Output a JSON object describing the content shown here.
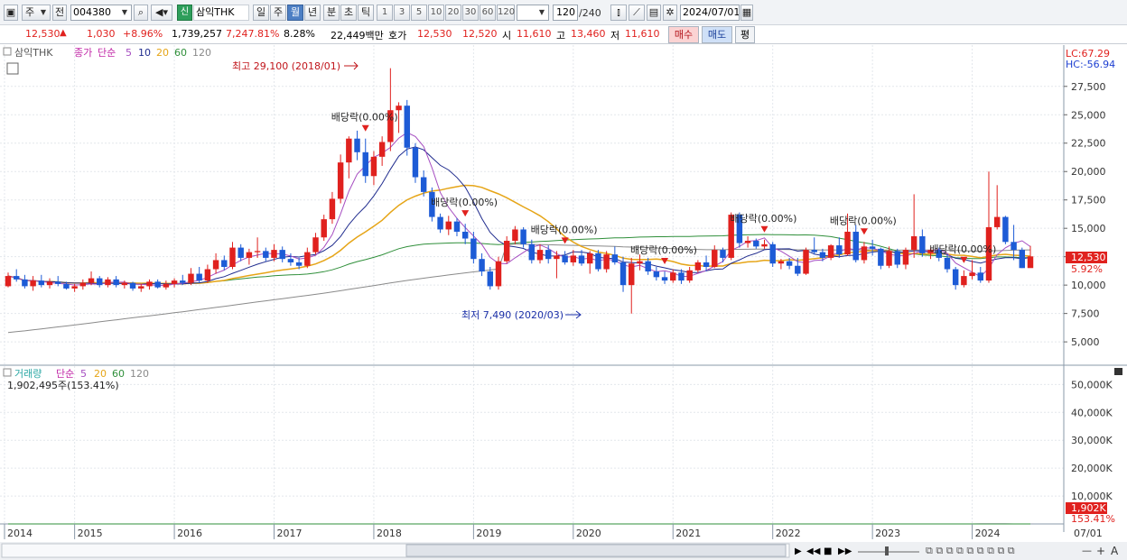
{
  "toolbar": {
    "mode": "주",
    "prev": "전",
    "code": "004380",
    "badge": "신",
    "name": "삼익THK",
    "periods": [
      "일",
      "주",
      "월",
      "년",
      "분",
      "초",
      "틱"
    ],
    "active_period": "월",
    "nums": [
      "1",
      "3",
      "5",
      "10",
      "20",
      "30",
      "60",
      "120"
    ],
    "count": "120",
    "total": "/240",
    "date": "2024/07/01"
  },
  "quote": {
    "price": "12,530",
    "arrow": "▲",
    "change": "1,030",
    "pct": "+8.96%",
    "volume": "1,739,257",
    "vol_ratio": "7,247.81%",
    "turnover": "8.28%",
    "amount": "22,449백만",
    "hoga_label": "호가",
    "ask": "12,530",
    "bid": "12,520",
    "open_label": "시",
    "open": "11,610",
    "high_label": "고",
    "high": "13,460",
    "low_label": "저",
    "low": "11,610",
    "buy": "매수",
    "sell": "매도",
    "avg": "평"
  },
  "price_panel": {
    "name": "삼익THK",
    "legend": [
      "종가",
      "단순",
      "5",
      "10",
      "20",
      "60",
      "120"
    ],
    "lc": "LC:67.29",
    "hc": "HC:-56.94",
    "max_label": "최고 29,100 (2018/01)",
    "min_label": "최저 7,490 (2020/03)",
    "last_price": "12,530",
    "last_pct": "5.92%",
    "ticks": [
      "27,500",
      "25,000",
      "22,500",
      "20,000",
      "17,500",
      "15,000",
      "12,500",
      "10,000",
      "7,500",
      "5,000"
    ],
    "dividends": [
      {
        "label": "배당락(0.00%)",
        "date": "2017/12"
      },
      {
        "label": "배당락(0.00%)",
        "date": "2018/12"
      },
      {
        "label": "배당락(0.00%)",
        "date": "2019/12"
      },
      {
        "label": "배당락(0.00%)",
        "date": "2020/12"
      },
      {
        "label": "배당락(0.00%)",
        "date": "2021/12"
      },
      {
        "label": "배당락(0.00%)",
        "date": "2022/12"
      },
      {
        "label": "배당락(0.00%)",
        "date": "2023/12"
      }
    ]
  },
  "volume_panel": {
    "name": "거래량",
    "legend": [
      "단순",
      "5",
      "20",
      "60",
      "120"
    ],
    "info": "1,902,495주(153.41%)",
    "last_vol": "1,902K",
    "last_pct": "153.41%",
    "ticks": [
      "50,000K",
      "40,000K",
      "30,000K",
      "20,000K",
      "10,000K"
    ]
  },
  "xaxis": {
    "labels": [
      "2014",
      "2015",
      "2016",
      "2017",
      "2018",
      "2019",
      "2020",
      "2021",
      "2022",
      "2023",
      "2024",
      "07/01"
    ]
  },
  "colors": {
    "up": "#e0211e",
    "down": "#1d5bd6",
    "ma5": "#a64ec1",
    "ma10": "#202c8e",
    "ma20": "#e6a517",
    "ma60": "#2f8f3a",
    "ma120": "#8a8a8a"
  },
  "chart_data": {
    "type": "candlestick",
    "ylim": [
      3500,
      30500
    ],
    "start": "2014/05",
    "candles": [
      [
        9900,
        11100,
        9800,
        10800
      ],
      [
        10800,
        11400,
        10300,
        10500
      ],
      [
        10500,
        10900,
        9700,
        9900
      ],
      [
        9900,
        10800,
        9500,
        10400
      ],
      [
        10400,
        10900,
        9800,
        10000
      ],
      [
        10000,
        10600,
        9700,
        10300
      ],
      [
        10300,
        10800,
        9900,
        10100
      ],
      [
        10100,
        10300,
        9600,
        9700
      ],
      [
        9700,
        10100,
        9400,
        9900
      ],
      [
        9900,
        10500,
        9600,
        10200
      ],
      [
        10200,
        11200,
        10000,
        10600
      ],
      [
        10600,
        10800,
        9800,
        10000
      ],
      [
        10000,
        10700,
        9800,
        10500
      ],
      [
        10500,
        10800,
        9800,
        10000
      ],
      [
        10000,
        10400,
        9700,
        10200
      ],
      [
        10200,
        10300,
        9500,
        9700
      ],
      [
        9700,
        10100,
        9400,
        9900
      ],
      [
        9900,
        10500,
        9600,
        10300
      ],
      [
        10300,
        10500,
        9700,
        9800
      ],
      [
        9800,
        10400,
        9600,
        10100
      ],
      [
        10100,
        10600,
        9800,
        10400
      ],
      [
        10400,
        10900,
        10000,
        10200
      ],
      [
        10200,
        11500,
        10000,
        11000
      ],
      [
        11000,
        11600,
        10200,
        10400
      ],
      [
        10400,
        11800,
        10200,
        11400
      ],
      [
        11400,
        12800,
        11000,
        12200
      ],
      [
        12200,
        12600,
        11300,
        11600
      ],
      [
        11600,
        13800,
        11400,
        13300
      ],
      [
        13300,
        13600,
        12100,
        12400
      ],
      [
        12400,
        13200,
        11800,
        12900
      ],
      [
        12900,
        14200,
        12400,
        13000
      ],
      [
        13000,
        13300,
        12100,
        12400
      ],
      [
        12400,
        13600,
        12100,
        13100
      ],
      [
        13100,
        13400,
        12000,
        12300
      ],
      [
        12300,
        12800,
        11700,
        12000
      ],
      [
        12000,
        12400,
        11400,
        11700
      ],
      [
        11700,
        13300,
        11500,
        12900
      ],
      [
        12900,
        14600,
        12700,
        14200
      ],
      [
        14200,
        16200,
        13900,
        15800
      ],
      [
        15800,
        18200,
        15400,
        17600
      ],
      [
        17600,
        21500,
        17200,
        20800
      ],
      [
        20800,
        23100,
        19400,
        22900
      ],
      [
        22900,
        23600,
        21000,
        21700
      ],
      [
        21700,
        22900,
        19000,
        19600
      ],
      [
        19600,
        21800,
        18800,
        21300
      ],
      [
        21300,
        23100,
        20500,
        22600
      ],
      [
        22600,
        29100,
        21800,
        25400
      ],
      [
        25400,
        26100,
        23400,
        25800
      ],
      [
        25800,
        26300,
        21400,
        22100
      ],
      [
        22100,
        22500,
        19000,
        19500
      ],
      [
        19500,
        20100,
        17800,
        18200
      ],
      [
        18200,
        18600,
        15600,
        16000
      ],
      [
        16000,
        16300,
        14600,
        14900
      ],
      [
        14900,
        16100,
        14400,
        15600
      ],
      [
        15600,
        15900,
        14300,
        14700
      ],
      [
        14700,
        15400,
        13600,
        14100
      ],
      [
        14100,
        14700,
        11900,
        12300
      ],
      [
        12300,
        12800,
        10800,
        11200
      ],
      [
        11200,
        11600,
        9600,
        9900
      ],
      [
        9900,
        12500,
        9600,
        12100
      ],
      [
        12100,
        14300,
        11900,
        13900
      ],
      [
        13900,
        15200,
        13600,
        14900
      ],
      [
        14900,
        15100,
        13300,
        13600
      ],
      [
        13600,
        14000,
        11900,
        12200
      ],
      [
        12200,
        13600,
        11900,
        13100
      ],
      [
        13100,
        13500,
        11900,
        12300
      ],
      [
        12300,
        13000,
        10600,
        12600
      ],
      [
        12600,
        13000,
        11800,
        12000
      ],
      [
        12000,
        13100,
        11700,
        12600
      ],
      [
        12600,
        13100,
        11700,
        11900
      ],
      [
        11900,
        13000,
        11000,
        12800
      ],
      [
        12800,
        13100,
        11200,
        11400
      ],
      [
        11400,
        13000,
        11100,
        12700
      ],
      [
        12700,
        13400,
        11800,
        12000
      ],
      [
        12000,
        12500,
        9400,
        10000
      ],
      [
        10000,
        12400,
        7490,
        11900
      ],
      [
        11900,
        12700,
        11300,
        12100
      ],
      [
        12100,
        12400,
        10900,
        11200
      ],
      [
        11200,
        11600,
        10400,
        10700
      ],
      [
        10700,
        11200,
        10100,
        10400
      ],
      [
        10400,
        11400,
        10200,
        11100
      ],
      [
        11100,
        11400,
        10100,
        10400
      ],
      [
        10400,
        11600,
        10200,
        11300
      ],
      [
        11300,
        12200,
        11100,
        12000
      ],
      [
        12000,
        12600,
        11200,
        11600
      ],
      [
        11600,
        13500,
        11500,
        13100
      ],
      [
        13100,
        13300,
        12000,
        12400
      ],
      [
        12400,
        16400,
        12200,
        16200
      ],
      [
        16200,
        16400,
        13300,
        13700
      ],
      [
        13700,
        14300,
        13300,
        13900
      ],
      [
        13900,
        14100,
        13200,
        13400
      ],
      [
        13400,
        14000,
        13200,
        13600
      ],
      [
        13600,
        13800,
        11600,
        11900
      ],
      [
        11900,
        12300,
        11400,
        12100
      ],
      [
        12100,
        12400,
        11400,
        11700
      ],
      [
        11700,
        12400,
        10800,
        11000
      ],
      [
        11000,
        13300,
        10900,
        13100
      ],
      [
        13100,
        14200,
        12700,
        12900
      ],
      [
        12900,
        13200,
        12100,
        12400
      ],
      [
        12400,
        13600,
        12200,
        13500
      ],
      [
        13500,
        14200,
        12400,
        12700
      ],
      [
        12700,
        16300,
        12600,
        14700
      ],
      [
        14700,
        15300,
        12000,
        12200
      ],
      [
        12200,
        13800,
        11900,
        13400
      ],
      [
        13400,
        14000,
        12600,
        13200
      ],
      [
        13200,
        13300,
        11400,
        11700
      ],
      [
        11700,
        13400,
        11500,
        13000
      ],
      [
        13000,
        13200,
        11500,
        11800
      ],
      [
        11800,
        13300,
        11400,
        13100
      ],
      [
        13100,
        18000,
        12400,
        14300
      ],
      [
        14300,
        14900,
        12500,
        12800
      ],
      [
        12800,
        13300,
        12300,
        13100
      ],
      [
        13100,
        13300,
        12100,
        12400
      ],
      [
        12400,
        12700,
        11100,
        11400
      ],
      [
        11400,
        11600,
        9600,
        10000
      ],
      [
        10000,
        11300,
        9800,
        10800
      ],
      [
        10800,
        12200,
        10500,
        11100
      ],
      [
        11100,
        11600,
        10200,
        10400
      ],
      [
        10400,
        20000,
        10200,
        15100
      ],
      [
        15100,
        18800,
        14900,
        16000
      ],
      [
        16000,
        16100,
        13600,
        13800
      ],
      [
        13800,
        15300,
        12200,
        13100
      ],
      [
        13100,
        13300,
        11500,
        11500
      ],
      [
        11500,
        13460,
        11610,
        12530
      ]
    ]
  }
}
